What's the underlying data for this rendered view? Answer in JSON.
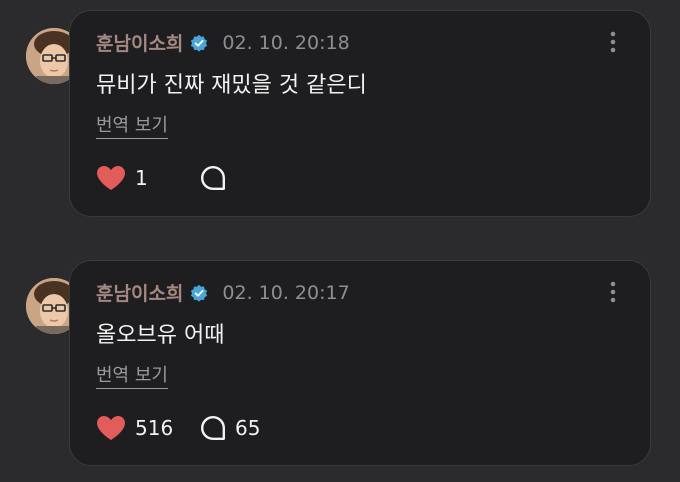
{
  "colors": {
    "background": "#2b2b2d",
    "card": "#1e1e20",
    "author": "#a48882",
    "verified": "#4aa6d8",
    "heart": "#e25c5c"
  },
  "icons": [
    "verified-badge-icon",
    "more-vertical-icon",
    "heart-icon",
    "comment-bubble-icon"
  ],
  "posts": [
    {
      "author": "훈남이소희",
      "time": "02. 10. 20:18",
      "text": "뮤비가 진짜 재밌을 것 같은디",
      "translate_label": "번역 보기",
      "likes": "1",
      "comments": ""
    },
    {
      "author": "훈남이소희",
      "time": "02. 10. 20:17",
      "text": "올오브유 어때",
      "translate_label": "번역 보기",
      "likes": "516",
      "comments": "65"
    }
  ]
}
